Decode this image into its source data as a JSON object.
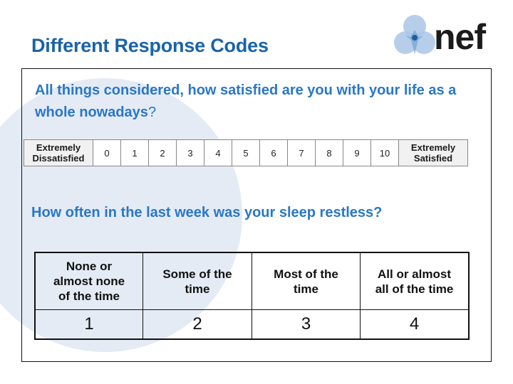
{
  "slide": {
    "title": "Different Response Codes",
    "accent_color": "#1a63a8",
    "question_color": "#2a77c6"
  },
  "logo": {
    "icon": "nef-three-circles-icon",
    "text": "nef"
  },
  "question1": {
    "text_line": "All things considered, how satisfied are you with your life as a whole nowadays",
    "qmark": "?",
    "scale": {
      "low_anchor": [
        "Extremely",
        "Dissatisfied"
      ],
      "high_anchor": [
        "Extremely",
        "Satisfied"
      ],
      "points": [
        "0",
        "1",
        "2",
        "3",
        "4",
        "5",
        "6",
        "7",
        "8",
        "9",
        "10"
      ]
    }
  },
  "question2": {
    "text": "How often in the last week was your sleep restless?",
    "options": [
      {
        "label_lines": [
          "None or",
          "almost none",
          "of the time"
        ],
        "code": "1"
      },
      {
        "label_lines": [
          "Some of the",
          "time"
        ],
        "code": "2"
      },
      {
        "label_lines": [
          "Most of the",
          "time"
        ],
        "code": "3"
      },
      {
        "label_lines": [
          "All or almost",
          "all of the time"
        ],
        "code": "4"
      }
    ]
  }
}
